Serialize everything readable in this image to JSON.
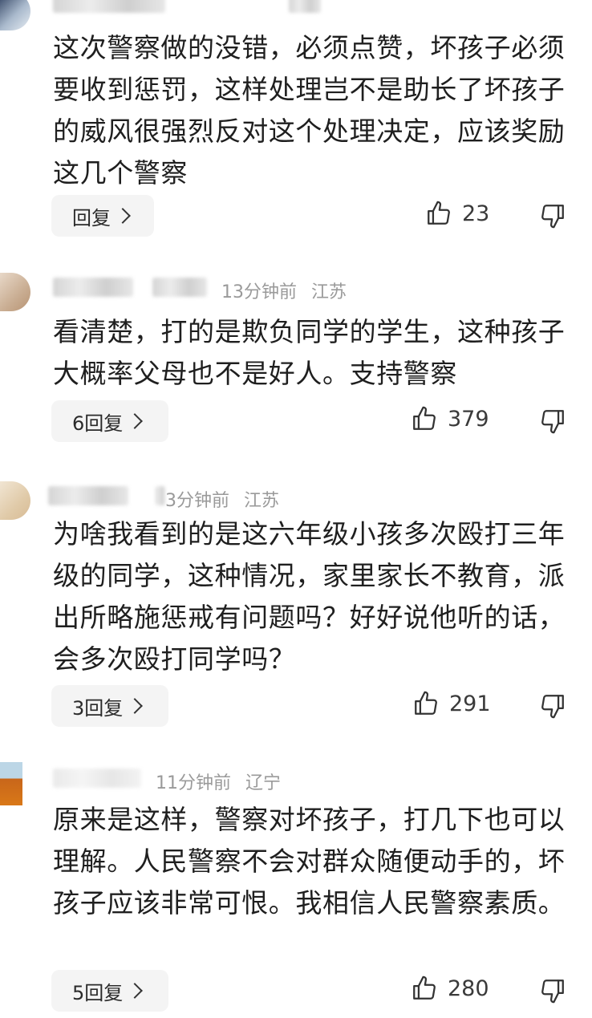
{
  "comments": [
    {
      "meta_time": "",
      "meta_location": "",
      "text": "这次警察做的没错，必须点赞，坏孩子必须要收到惩罚，这样处理岂不是助长了坏孩子的威风很强烈反对这个处理决定，应该奖励这几个警察",
      "reply_label": "回复",
      "likes": "23"
    },
    {
      "meta_time": "13分钟前",
      "meta_location": "江苏",
      "text": "看清楚，打的是欺负同学的学生，这种孩子大概率父母也不是好人。支持警察",
      "reply_label": "6回复",
      "likes": "379"
    },
    {
      "meta_time": "3分钟前",
      "meta_location": "江苏",
      "text": "为啥我看到的是这六年级小孩多次殴打三年级的同学，这种情况，家里家长不教育，派出所略施惩戒有问题吗？好好说他听的话，会多次殴打同学吗？",
      "reply_label": "3回复",
      "likes": "291"
    },
    {
      "meta_time": "11分钟前",
      "meta_location": "辽宁",
      "text": "原来是这样，警察对坏孩子，打几下也可以理解。人民警察不会对群众随便动手的，坏孩子应该非常可恨。我相信人民警察素质。",
      "reply_label": "5回复",
      "likes": "280"
    }
  ],
  "icons": {
    "like": "thumbs-up-icon",
    "dislike": "thumbs-down-icon",
    "chevron": "chevron-right-icon"
  }
}
